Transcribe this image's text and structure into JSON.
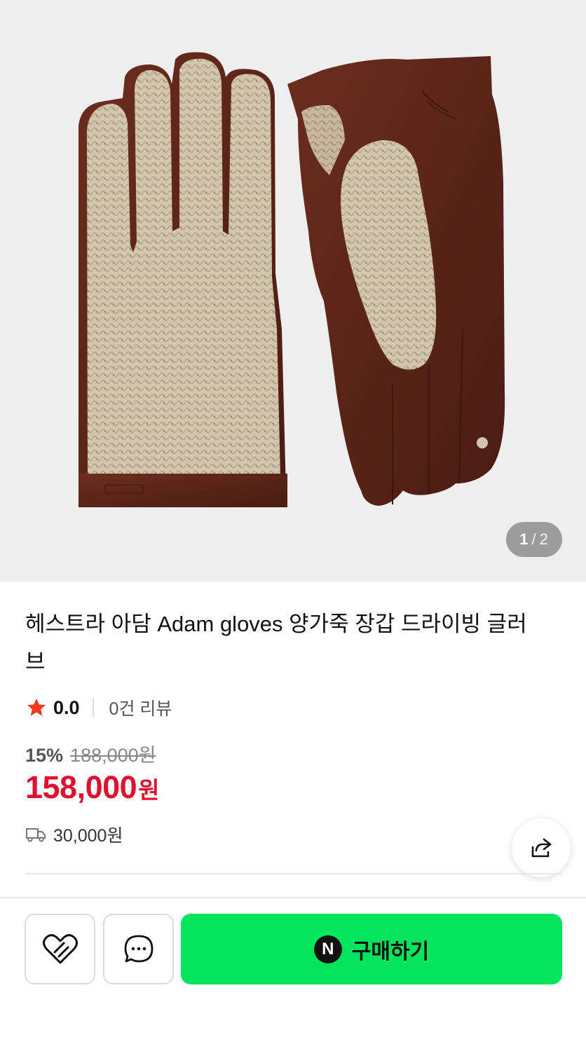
{
  "gallery": {
    "current_page": "1",
    "separator": "/",
    "total_pages": "2",
    "image_subject": "gloves"
  },
  "product": {
    "title": "헤스트라 아담 Adam gloves 양가죽 장갑 드라이빙 글러브",
    "rating": "0.0",
    "review_count": "0건 리뷰",
    "discount": "15%",
    "original_price": "188,000원",
    "sale_price": "158,000",
    "sale_price_unit": "원",
    "shipping_fee": "30,000원"
  },
  "icons": {
    "star": "star-icon",
    "truck": "truck-icon",
    "share": "share-icon",
    "wish": "heart-icon",
    "chat": "chat-bubble-icon",
    "naver": "naver-n-icon"
  },
  "bottom_bar": {
    "naver_badge": "N",
    "buy_label": "구매하기"
  },
  "colors": {
    "accent_red": "#e0102f",
    "star": "#f23b1e",
    "buy_green": "#03e55c",
    "image_bg": "#eeeeef"
  }
}
